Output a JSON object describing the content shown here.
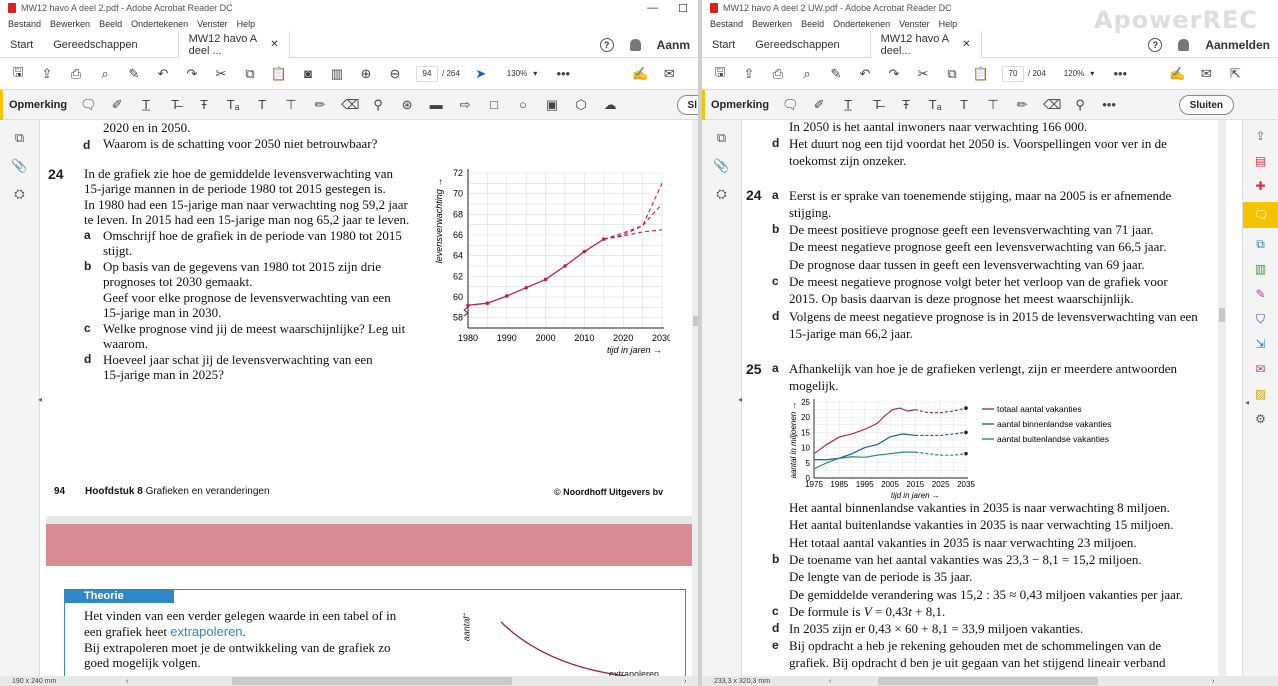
{
  "watermark": "ApowerREC",
  "left": {
    "title": "MW12 havo A deel 2.pdf - Adobe Acrobat Reader DC",
    "menu": [
      "Bestand",
      "Bewerken",
      "Beeld",
      "Ondertekenen",
      "Venster",
      "Help"
    ],
    "tabs": {
      "start": "Start",
      "tools": "Gereedschappen",
      "doc": "MW12 havo A deel ...",
      "login": "Aanm"
    },
    "page_current": "94",
    "page_total": "/ 264",
    "zoom": "130%",
    "comment_label": "Opmerking",
    "close_label": "Sl",
    "status": "190 x 240 mm",
    "doc": {
      "prev_lines": [
        "2020 en in 2050.",
        "Waarom is de schatting voor 2050 niet betrouwbaar?"
      ],
      "prev_letter": "d",
      "q24": {
        "num": "24",
        "intro": [
          "In de grafiek zie hoe de gemiddelde levensverwachting van",
          "15-jarige mannen in de periode 1980 tot 2015 gestegen is.",
          "In 1980 had een 15-jarige man naar verwachting nog 59,2 jaar",
          "te leven. In 2015 had een 15-jarige man nog 65,2 jaar te leven."
        ],
        "a": [
          "Omschrijf hoe de grafiek in de periode van 1980 tot 2015",
          "stijgt."
        ],
        "b": [
          "Op basis van de gegevens van 1980 tot 2015 zijn drie",
          "prognoses tot 2030 gemaakt.",
          "Geef voor elke prognose de levensverwachting van een",
          "15-jarige man in 2030."
        ],
        "c": [
          "Welke prognose vind jij de meest waarschijnlijke? Leg uit",
          "waarom."
        ],
        "d": [
          "Hoeveel jaar schat jij de levensverwachting van een",
          "15-jarige man in 2025?"
        ]
      },
      "footer": {
        "page": "94",
        "chapter": "Hoofdstuk 8",
        "chapter_title": "Grafieken en veranderingen",
        "publisher": "© Noordhoff Uitgevers bv"
      },
      "theory": {
        "label": "Theorie",
        "lines": [
          "Het vinden van een verder gelegen waarde in een tabel of in",
          "een grafiek heet ",
          "extrapoleren",
          ".",
          "Bij extrapoleren moet je de ontwikkeling van de grafiek zo",
          "goed mogelijk volgen."
        ],
        "axis": "aantal",
        "extra": "extrapoleren"
      }
    },
    "chart_data": {
      "type": "line",
      "ylabel": "levensverwachting",
      "xlabel": "tijd in jaren",
      "x_ticks": [
        "1980",
        "1990",
        "2000",
        "2010",
        "2020",
        "2030"
      ],
      "y_ticks": [
        "58",
        "60",
        "62",
        "64",
        "66",
        "68",
        "70",
        "72"
      ],
      "ylim": [
        57,
        72
      ],
      "xlim": [
        1980,
        2030
      ],
      "x": [
        1980,
        1985,
        1990,
        1995,
        2000,
        2005,
        2010,
        2015
      ],
      "values": [
        59.2,
        59.4,
        60.1,
        60.9,
        61.7,
        63.0,
        64.4,
        65.6
      ],
      "prognoses": [
        {
          "values": [
            [
              2015,
              65.6
            ],
            [
              2020,
              66.2
            ],
            [
              2025,
              66.9
            ],
            [
              2030,
              71.0
            ]
          ]
        },
        {
          "values": [
            [
              2015,
              65.6
            ],
            [
              2020,
              66.0
            ],
            [
              2025,
              66.9
            ],
            [
              2030,
              69.0
            ]
          ]
        },
        {
          "values": [
            [
              2015,
              65.6
            ],
            [
              2020,
              65.9
            ],
            [
              2025,
              66.3
            ],
            [
              2030,
              66.5
            ]
          ]
        }
      ]
    }
  },
  "right": {
    "title": "MW12 havo A deel 2 UW.pdf - Adobe Acrobat Reader DC",
    "menu": [
      "Bestand",
      "Bewerken",
      "Beeld",
      "Ondertekenen",
      "Venster",
      "Help"
    ],
    "tabs": {
      "start": "Start",
      "tools": "Gereedschappen",
      "doc": "MW12 havo A deel...",
      "login": "Aanmelden"
    },
    "page_current": "70",
    "page_total": "/ 204",
    "zoom": "120%",
    "comment_label": "Opmerking",
    "close_label": "Sluiten",
    "status": "233,3 x 320,3 mm",
    "doc": {
      "top_line": "In 2050 is het aantal inwoners naar verwachting 166 000.",
      "d_prev": [
        "Het duurt nog een tijd voordat het 2050 is. Voorspellingen voor ver in de",
        "toekomst zijn onzeker."
      ],
      "a24": {
        "num": "24",
        "a": [
          "Eerst is er sprake van toenemende stijging, maar na 2005 is er afnemende",
          "stijging."
        ],
        "b": [
          "De meest positieve prognose geeft een levensverwachting van 71 jaar.",
          "De meest negatieve prognose geeft een levensverwachting van 66,5 jaar.",
          "De prognose daar tussen in geeft een levensverwachting van 69 jaar."
        ],
        "c": [
          "De meest negatieve prognose volgt beter het verloop van de grafiek voor",
          "2015. Op basis daarvan is deze prognose het meest waarschijnlijk."
        ],
        "d": [
          "Volgens de meest negatieve prognose is in 2015 de levensverwachting van een",
          "15-jarige man 66,2 jaar."
        ]
      },
      "a25": {
        "num": "25",
        "a": [
          "Afhankelijk van hoe je de grafieken verlengt, zijn er meerdere antwoorden",
          "mogelijk."
        ],
        "after": [
          "Het aantal binnenlandse vakanties in 2035 is naar verwachting 8 miljoen.",
          "Het aantal buitenlandse vakanties in 2035 is naar verwachting 15 miljoen.",
          "Het totaal aantal vakanties in 2035 is naar verwachting 23 miljoen."
        ],
        "b": [
          "De toename van het aantal vakanties was 23,3 − 8,1 = 15,2 miljoen.",
          "De lengte van de periode is 35 jaar.",
          "De gemiddelde verandering was 15,2 : 35 ≈ 0,43 miljoen vakanties per jaar."
        ],
        "c": [
          "De formule is ",
          "V",
          " = 0,43",
          "t",
          " + 8,1."
        ],
        "d": [
          "In 2035 zijn er 0,43 × 60 + 8,1 = 33,9 miljoen vakanties."
        ],
        "e": [
          "Bij opdracht a heb je rekening gehouden met de schommelingen van de",
          "grafiek. Bij opdracht d ben je uit gegaan van het stijgend lineair verband"
        ]
      }
    },
    "chart_data": {
      "type": "line",
      "ylabel": "aantal in miljoenen",
      "xlabel": "tijd in jaren",
      "x_ticks": [
        "1975",
        "1985",
        "1995",
        "2005",
        "2015",
        "2025",
        "2035"
      ],
      "y_ticks": [
        "0",
        "5",
        "10",
        "15",
        "20",
        "25"
      ],
      "ylim": [
        0,
        25
      ],
      "xlim": [
        1975,
        2035
      ],
      "series": [
        {
          "name": "totaal aantal vakanties",
          "color": "#a8304a",
          "values": [
            [
              1975,
              8
            ],
            [
              1980,
              11
            ],
            [
              1985,
              13.5
            ],
            [
              1990,
              14.5
            ],
            [
              1995,
              16
            ],
            [
              2000,
              18
            ],
            [
              2003,
              20.5
            ],
            [
              2006,
              22.5
            ],
            [
              2009,
              23
            ],
            [
              2012,
              22
            ],
            [
              2015,
              22.5
            ],
            [
              2020,
              21.5
            ],
            [
              2025,
              21.5
            ],
            [
              2030,
              22
            ],
            [
              2035,
              23
            ]
          ]
        },
        {
          "name": "aantal binnenlandse vakanties",
          "color": "#1f5f8a",
          "values": [
            [
              1975,
              6
            ],
            [
              1980,
              6
            ],
            [
              1985,
              6.5
            ],
            [
              1990,
              8
            ],
            [
              1995,
              10
            ],
            [
              2000,
              11
            ],
            [
              2005,
              13.5
            ],
            [
              2010,
              14.5
            ],
            [
              2015,
              14
            ],
            [
              2020,
              14
            ],
            [
              2025,
              14
            ],
            [
              2030,
              14.5
            ],
            [
              2035,
              15
            ]
          ]
        },
        {
          "name": "aantal buitenlandse vakanties",
          "color": "#2a8a7a",
          "values": [
            [
              1975,
              3
            ],
            [
              1980,
              5
            ],
            [
              1985,
              6.5
            ],
            [
              1990,
              7
            ],
            [
              1995,
              6.8
            ],
            [
              2000,
              7.5
            ],
            [
              2005,
              8
            ],
            [
              2010,
              8.5
            ],
            [
              2015,
              8.5
            ],
            [
              2020,
              8
            ],
            [
              2025,
              7.5
            ],
            [
              2030,
              7.5
            ],
            [
              2035,
              8
            ]
          ]
        }
      ],
      "dashed_from": 2015
    }
  }
}
